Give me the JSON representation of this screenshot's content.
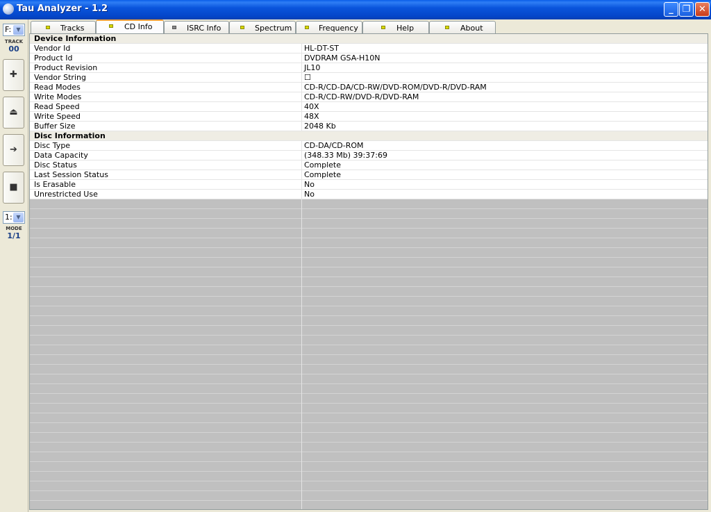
{
  "window": {
    "title": "Tau Analyzer - 1.2",
    "buttons": {
      "minimize": "_",
      "maximize": "❐",
      "close": "✕"
    }
  },
  "leftbar": {
    "drive_select": "F:",
    "track_label": "TRACK",
    "track_value": "00",
    "buttons": {
      "add": "✚",
      "eject": "⏏",
      "play": "➔",
      "stop": "■"
    },
    "mode_select": "1:",
    "mode_label": "MODE",
    "mode_value": "1/1"
  },
  "tabs": [
    {
      "label": "Tracks",
      "led": "yellow"
    },
    {
      "label": "CD Info",
      "led": "yellow",
      "active": true
    },
    {
      "label": "ISRC Info",
      "led": "gray"
    },
    {
      "label": "Spectrum",
      "led": "yellow"
    },
    {
      "label": "Frequency",
      "led": "yellow"
    },
    {
      "label": "Help",
      "led": "yellow"
    },
    {
      "label": "About",
      "led": "yellow"
    }
  ],
  "device_info": {
    "header": "Device Information",
    "rows": [
      {
        "label": "Vendor Id",
        "value": "HL-DT-ST"
      },
      {
        "label": "Product Id",
        "value": "DVDRAM GSA-H10N"
      },
      {
        "label": "Product Revision",
        "value": "JL10"
      },
      {
        "label": "Vendor String",
        "value": "☐"
      },
      {
        "label": "Read Modes",
        "value": "CD-R/CD-DA/CD-RW/DVD-ROM/DVD-R/DVD-RAM"
      },
      {
        "label": "Write Modes",
        "value": "CD-R/CD-RW/DVD-R/DVD-RAM"
      },
      {
        "label": "Read Speed",
        "value": "40X"
      },
      {
        "label": "Write Speed",
        "value": "48X"
      },
      {
        "label": "Buffer Size",
        "value": "2048 Kb"
      }
    ]
  },
  "disc_info": {
    "header": "Disc Information",
    "rows": [
      {
        "label": "Disc Type",
        "value": "CD-DA/CD-ROM"
      },
      {
        "label": "Data Capacity",
        "value": "(348.33 Mb) 39:37:69"
      },
      {
        "label": "Disc Status",
        "value": "Complete"
      },
      {
        "label": "Last Session Status",
        "value": "Complete"
      },
      {
        "label": "Is Erasable",
        "value": "No"
      },
      {
        "label": "Unrestricted Use",
        "value": "No"
      }
    ]
  }
}
